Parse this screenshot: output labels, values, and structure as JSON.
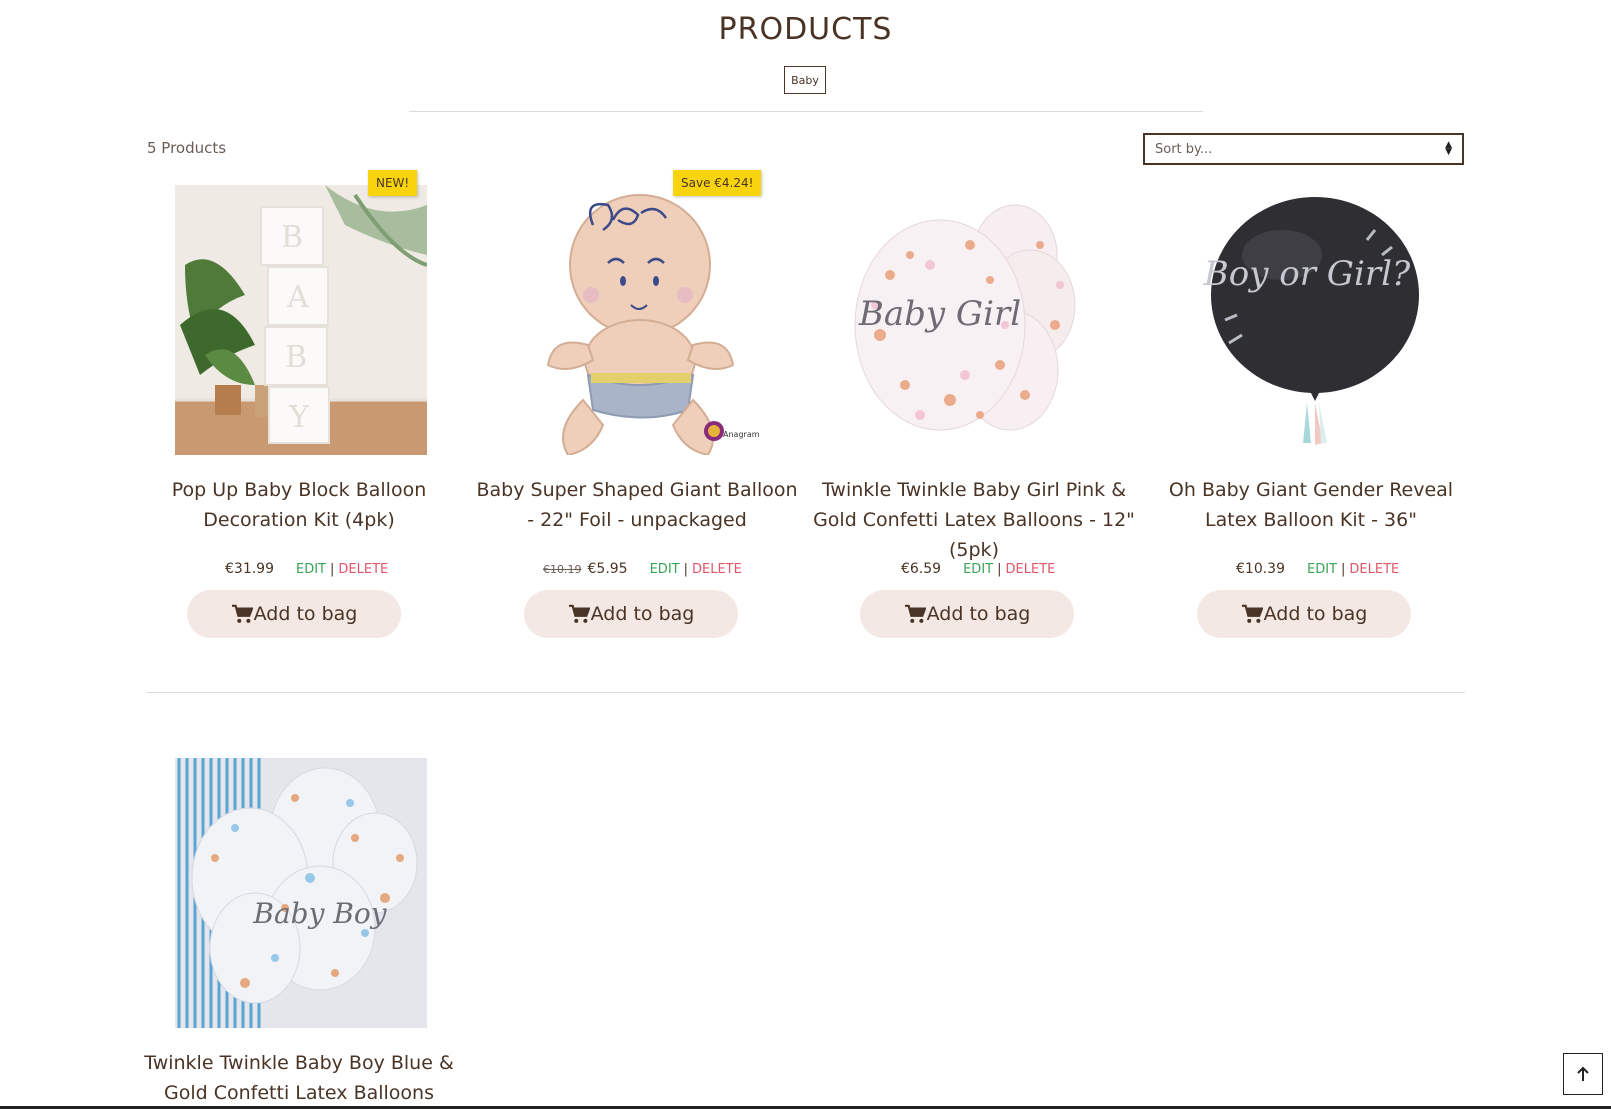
{
  "page_title": "PRODUCTS",
  "category_tag": "Baby",
  "product_count": "5 Products",
  "sort": {
    "selected": "Sort by..."
  },
  "labels": {
    "edit": "EDIT",
    "separator": "|",
    "delete": "DELETE",
    "add_to_bag": "Add to bag"
  },
  "products": [
    {
      "title": "Pop Up Baby Block Balloon Decoration Kit (4pk)",
      "badge": "NEW!",
      "price": "€31.99",
      "old_price": ""
    },
    {
      "title": "Baby Super Shaped Giant Balloon - 22\" Foil - unpackaged",
      "badge": "Save €4.24!",
      "price": "€5.95",
      "old_price": "€10.19"
    },
    {
      "title": "Twinkle Twinkle Baby Girl Pink & Gold Confetti Latex Balloons - 12\" (5pk)",
      "badge": "",
      "price": "€6.59",
      "old_price": ""
    },
    {
      "title": "Oh Baby Giant Gender Reveal Latex Balloon Kit - 36\"",
      "badge": "",
      "price": "€10.39",
      "old_price": ""
    },
    {
      "title": "Twinkle Twinkle Baby Boy Blue & Gold Confetti Latex Balloons",
      "badge": "",
      "price": "",
      "old_price": ""
    }
  ],
  "image_text": {
    "blocks": [
      "B",
      "A",
      "B",
      "Y"
    ],
    "girl_balloon": "Baby Girl",
    "reveal_balloon": "Boy or Girl?",
    "boy_balloon": "Baby Boy",
    "anagram_logo": "Anagram"
  },
  "colors": {
    "text": "#4a3426",
    "badge": "#f8d40e",
    "edit": "#3aa35a",
    "delete": "#e0566a",
    "button_bg": "#f4e8e4"
  },
  "icons": {
    "cart": "cart-icon",
    "scroll_top": "arrow-up-icon"
  }
}
